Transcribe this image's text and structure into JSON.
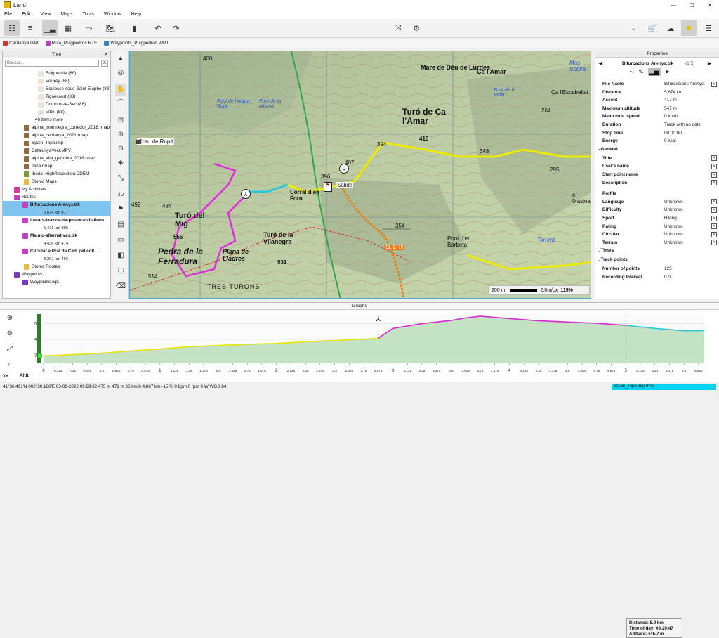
{
  "window": {
    "title": "Land",
    "controls": [
      "—",
      "☐",
      "✕"
    ]
  },
  "menu": [
    "File",
    "Edit",
    "View",
    "Maps",
    "Tools",
    "Window",
    "Help"
  ],
  "tabs": [
    {
      "label": "Cerdanya.IMP",
      "color": "#c63c3c"
    },
    {
      "label": "Ruta_Puigpedros.RTE",
      "color": "#c03ec0"
    },
    {
      "label": "Waypoints_Puigpedros.WPT",
      "color": "#3a7fbf"
    }
  ],
  "tree": {
    "title": "Tree",
    "search_placeholder": "Buscar...",
    "clear_label": "X",
    "items": [
      {
        "label": "Bulgneville (88)",
        "icon": "doc"
      },
      {
        "label": "Vouxey (88)",
        "icon": "doc"
      },
      {
        "label": "Soulosse-sous-Saint-Elophe (88)",
        "icon": "doc"
      },
      {
        "label": "Tignecourt (88)",
        "icon": "doc"
      },
      {
        "label": "Dombrot-le-Sec (88)",
        "icon": "doc"
      },
      {
        "label": "Vittel (88)",
        "icon": "doc"
      },
      {
        "label": "46 items more",
        "icon": "none"
      },
      {
        "label": "alpina_montnegre_corredor_2018.rmap",
        "icon": "map"
      },
      {
        "label": "alpina_cerdanya_2021.rmap",
        "icon": "map"
      },
      {
        "label": "Spain_Topo.imp",
        "icon": "map"
      },
      {
        "label": "CatalunyaVect.MPV",
        "icon": "map"
      },
      {
        "label": "alpina_alta_garrotxa_2018.rmap",
        "icon": "map"
      },
      {
        "label": "llana.rmap",
        "icon": "map"
      },
      {
        "label": "Iberia_HighResolution.CDEM",
        "icon": "dem"
      },
      {
        "label": "Stored Maps",
        "icon": "folder"
      },
      {
        "label": "My Activities",
        "icon": "activity"
      },
      {
        "label": "Routes",
        "icon": "route"
      },
      {
        "label": "Bifurcacions Arenys.trk",
        "sub": "5,674 km  417",
        "selected": true
      },
      {
        "label": "llanars-la-roca-de-pelanca-vilallons",
        "sub": "5,471 km  306"
      },
      {
        "label": "Malniu-alternatives.trk",
        "sub": "4,436 km  474"
      },
      {
        "label": "Circular a Prat de Cadí pel coll...",
        "sub": "8,297 km  466"
      },
      {
        "label": "Stored Routes",
        "icon": "folder"
      },
      {
        "label": "Waypoints",
        "icon": "wpt"
      },
      {
        "label": "Waypoints.wpt",
        "icon": "wpt"
      }
    ]
  },
  "map": {
    "labels": [
      "Mare de Déu de Lurdes",
      "Ca l'Amar",
      "Turó de Ca l'Amar",
      "Creu de Rupit",
      "Turó del Mig",
      "Pedra de la Ferradura",
      "Plana de Lladres",
      "Turó de la Vilanegra",
      "Corral d'en Forn",
      "Salida",
      "Font de la Polla",
      "Ca l'Escabellat",
      "el Masjoan",
      "Pont d'en Barbeta",
      "Torrent",
      "TRES TURONS",
      "SL C-76",
      "Font de l'Aigua Roja",
      "Font de la Mitana",
      "Mas Sobirà"
    ],
    "elevations": [
      "400",
      "416",
      "394",
      "348",
      "295",
      "407",
      "396",
      "354",
      "484",
      "492",
      "555",
      "531",
      "514",
      "264"
    ],
    "scale_label": "200 m",
    "zoom_ppx": "2.0m/px",
    "zoom_pct": "119%"
  },
  "properties": {
    "title": "Properties",
    "track_name": "Bifurcacions Arenys.trk",
    "counter": "(1/5)",
    "rows": [
      {
        "k": "File Name",
        "v": "Bifurcacions Arenys.",
        "edit": true
      },
      {
        "k": "Distance",
        "v": "5,674 km"
      },
      {
        "k": "Ascent",
        "v": "417 m"
      },
      {
        "k": "Maximum altitude",
        "v": "547 m"
      },
      {
        "k": "Mean mov. speed",
        "v": "0 km/h"
      },
      {
        "k": "Duration",
        "v": "Track with no date"
      },
      {
        "k": "Stop time",
        "v": "00:00:00"
      },
      {
        "k": "Energy",
        "v": "0 kcal"
      }
    ],
    "general_label": "General",
    "general": [
      {
        "k": "Title",
        "v": "",
        "edit": true
      },
      {
        "k": "User's name",
        "v": "",
        "edit": true
      },
      {
        "k": "Start point name",
        "v": "",
        "edit": true
      },
      {
        "k": "Description",
        "v": "",
        "edit": true
      },
      {
        "k": "Profile",
        "v": ""
      },
      {
        "k": "Language",
        "v": "Unknown",
        "edit": true
      },
      {
        "k": "Difficulty",
        "v": "Unknown",
        "edit": true
      },
      {
        "k": "Sport",
        "v": "Hiking",
        "edit": true
      },
      {
        "k": "Rating",
        "v": "Unknown",
        "edit": true
      },
      {
        "k": "Circular",
        "v": "Unknown",
        "edit": true
      },
      {
        "k": "Terrain",
        "v": "Unknown",
        "edit": true
      }
    ],
    "times_label": "Times",
    "trackpoints_label": "Track points",
    "trackpoints": [
      {
        "k": "Number of points",
        "v": "125"
      },
      {
        "k": "Recording Interval",
        "v": "0.0"
      }
    ]
  },
  "graphs": {
    "title": "Graphs",
    "y_label": "Altit.",
    "chart_data": {
      "type": "area",
      "xlabel": "",
      "ylabel": "Altit.",
      "y_ticks": [
        "500",
        "400",
        "300"
      ],
      "x_ticks": [
        "0",
        "0.125",
        "0.25",
        "0.375",
        "0.5",
        "0.625",
        "0.75",
        "0.875",
        "1",
        "1.125",
        "1.25",
        "1.375",
        "1.5",
        "1.625",
        "1.75",
        "1.875",
        "2",
        "2.125",
        "2.25",
        "2.375",
        "2.5",
        "2.625",
        "2.75",
        "2.875",
        "3",
        "3.125",
        "3.25",
        "3.375",
        "3.5",
        "3.625",
        "3.75",
        "3.875",
        "4",
        "4.125",
        "4.25",
        "4.375",
        "4.5",
        "4.625",
        "4.75",
        "4.875",
        "5",
        "5.125",
        "5.25",
        "5.375",
        "5.5",
        "5.625"
      ],
      "xlim": [
        0,
        5.674
      ],
      "ylim": [
        250,
        560
      ],
      "x": [
        0,
        0.25,
        0.5,
        0.75,
        1,
        1.25,
        1.5,
        1.75,
        2,
        2.25,
        2.5,
        2.75,
        2.875,
        3,
        3.25,
        3.5,
        3.625,
        3.75,
        4,
        4.25,
        4.5,
        4.75,
        5,
        5.25,
        5.5,
        5.674
      ],
      "y": [
        297,
        305,
        314,
        328,
        340,
        355,
        362,
        370,
        375,
        386,
        393,
        402,
        408,
        470,
        500,
        520,
        536,
        547,
        532,
        518,
        510,
        502,
        489,
        470,
        455,
        456
      ],
      "segment_colors": [
        {
          "from": 0,
          "to": 2.875,
          "color": "#e9e400"
        },
        {
          "from": 2.875,
          "to": 5.0,
          "color": "#d82bd0"
        },
        {
          "from": 5.0,
          "to": 5.674,
          "color": "#28c7d9"
        }
      ],
      "tooltip": {
        "distance": "Distance: 5.0 km",
        "time": "Time of day: 09:29:47",
        "altitude": "Altitude: 445.7 m"
      }
    }
  },
  "status": {
    "text": "41°36.491'N 002°30.188'E  03-08-2022  09:29:32  475 m  471 m  36 km/h  4,867 km  -15 %  0 bpm  0 rpm  0 W  WGS 84",
    "progress_label": "Spain_Topo.imp  97%",
    "progress": 0.97
  }
}
